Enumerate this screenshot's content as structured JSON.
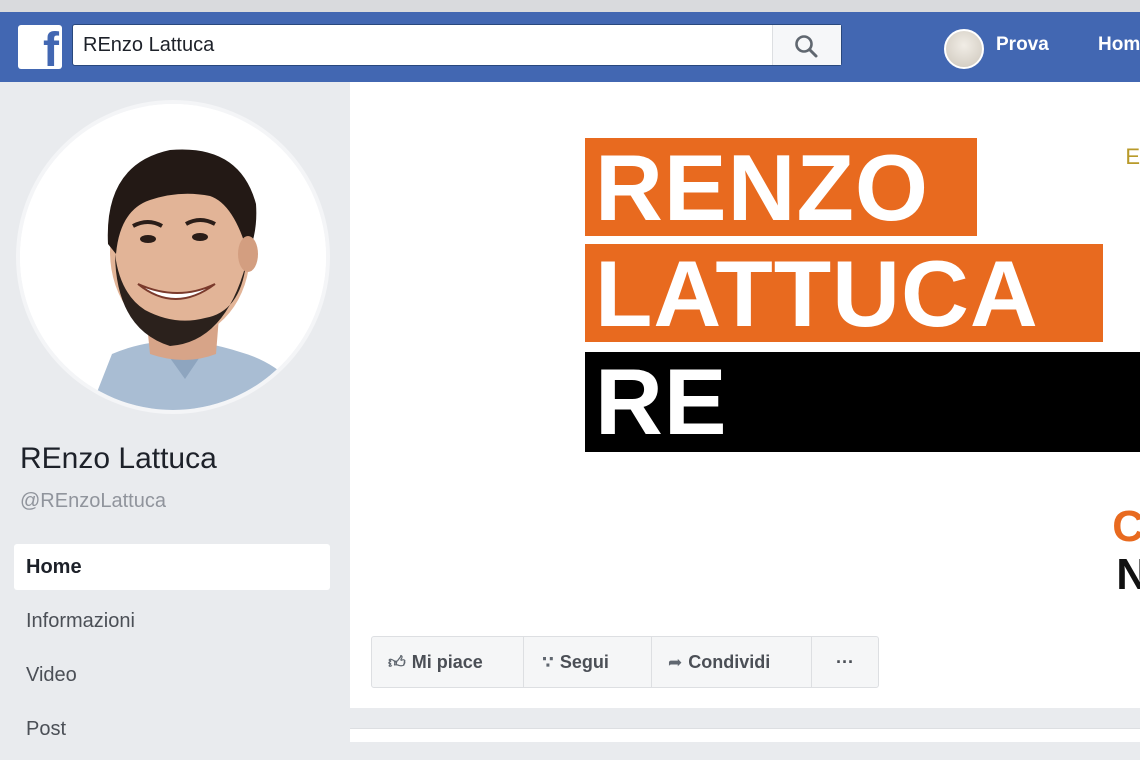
{
  "header": {
    "search_value": "REnzo Lattuca",
    "profile_name": "Prova",
    "home_label": "Home"
  },
  "page": {
    "name": "REnzo Lattuca",
    "handle": "@REnzoLattuca"
  },
  "nav": {
    "items": [
      {
        "label": "Home",
        "active": true
      },
      {
        "label": "Informazioni",
        "active": false
      },
      {
        "label": "Video",
        "active": false
      },
      {
        "label": "Post",
        "active": false
      }
    ]
  },
  "cover": {
    "line1": "RENZO",
    "line2": "LATTUCA",
    "line3": "RE",
    "edge_top": "E",
    "edge_mid": "C",
    "edge_low": "N",
    "colors": {
      "accent": "#e86a1f",
      "dark": "#000000"
    }
  },
  "actions": {
    "like": "Mi piace",
    "follow": "Segui",
    "share": "Condividi",
    "more": "···"
  },
  "icons": [
    "facebook-logo-icon",
    "search-icon",
    "like-icon",
    "follow-rss-icon",
    "share-icon",
    "more-icon"
  ],
  "colors": {
    "brand_blue": "#4267b2",
    "background": "#e9ebee"
  }
}
